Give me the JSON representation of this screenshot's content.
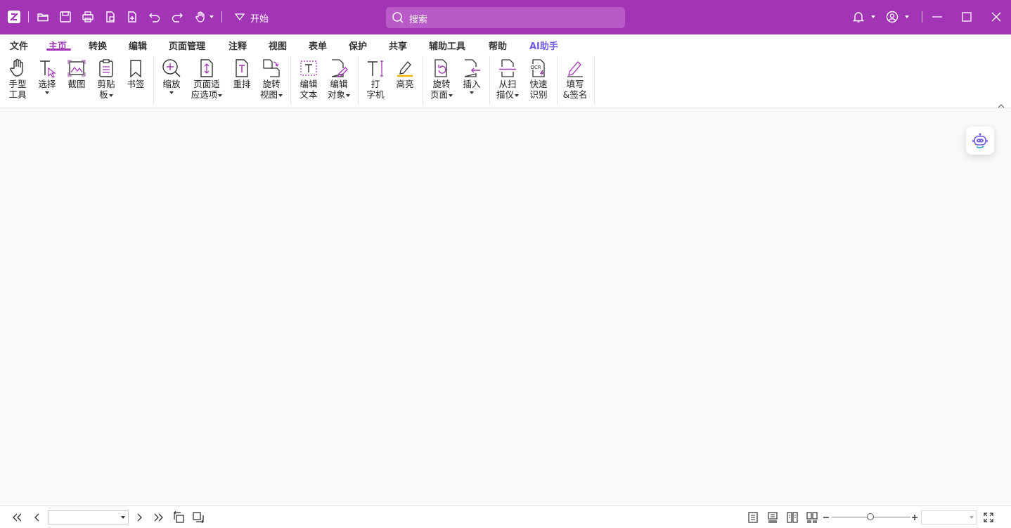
{
  "colors": {
    "brand": "#a234b6",
    "search_bg": "#b85ac8",
    "ai_accent": "#6d5ce8"
  },
  "titlebar": {
    "quick_access": [
      "app-logo-icon",
      "open-folder-icon",
      "save-icon",
      "print-icon",
      "export-icon",
      "new-file-icon",
      "undo-icon",
      "redo-icon",
      "hand-tool-icon"
    ],
    "start_label": "开始",
    "search_placeholder": "搜索"
  },
  "menu": {
    "tabs": [
      "文件",
      "主页",
      "转换",
      "编辑",
      "页面管理",
      "注释",
      "视图",
      "表单",
      "保护",
      "共享",
      "辅助工具",
      "帮助",
      "AI助手"
    ],
    "active": "主页"
  },
  "ribbon": {
    "hand_tool": {
      "line1": "手型",
      "line2": "工具"
    },
    "select": {
      "line1": "选择"
    },
    "snapshot": {
      "line1": "截图"
    },
    "clipboard": {
      "line1": "剪贴",
      "line2": "板"
    },
    "bookmark": {
      "line1": "书签"
    },
    "zoom": {
      "line1": "缩放"
    },
    "fit_page": {
      "line1": "页面适",
      "line2": "应选项"
    },
    "reflow": {
      "line1": "重排"
    },
    "rotate_view": {
      "line1": "旋转",
      "line2": "视图"
    },
    "edit_text": {
      "line1": "编辑",
      "line2": "文本"
    },
    "edit_object": {
      "line1": "编辑",
      "line2": "对象"
    },
    "typewriter": {
      "line1": "打",
      "line2": "字机"
    },
    "highlight": {
      "line1": "高亮"
    },
    "rotate_page": {
      "line1": "旋转",
      "line2": "页面"
    },
    "insert": {
      "line1": "插入"
    },
    "from_scanner": {
      "line1": "从扫",
      "line2": "描仪"
    },
    "quick_ocr": {
      "line1": "快速",
      "line2": "识别"
    },
    "fill_sign": {
      "line1": "填写",
      "line2": "&签名"
    }
  },
  "statusbar": {
    "page_value": "",
    "zoom_value": ""
  }
}
